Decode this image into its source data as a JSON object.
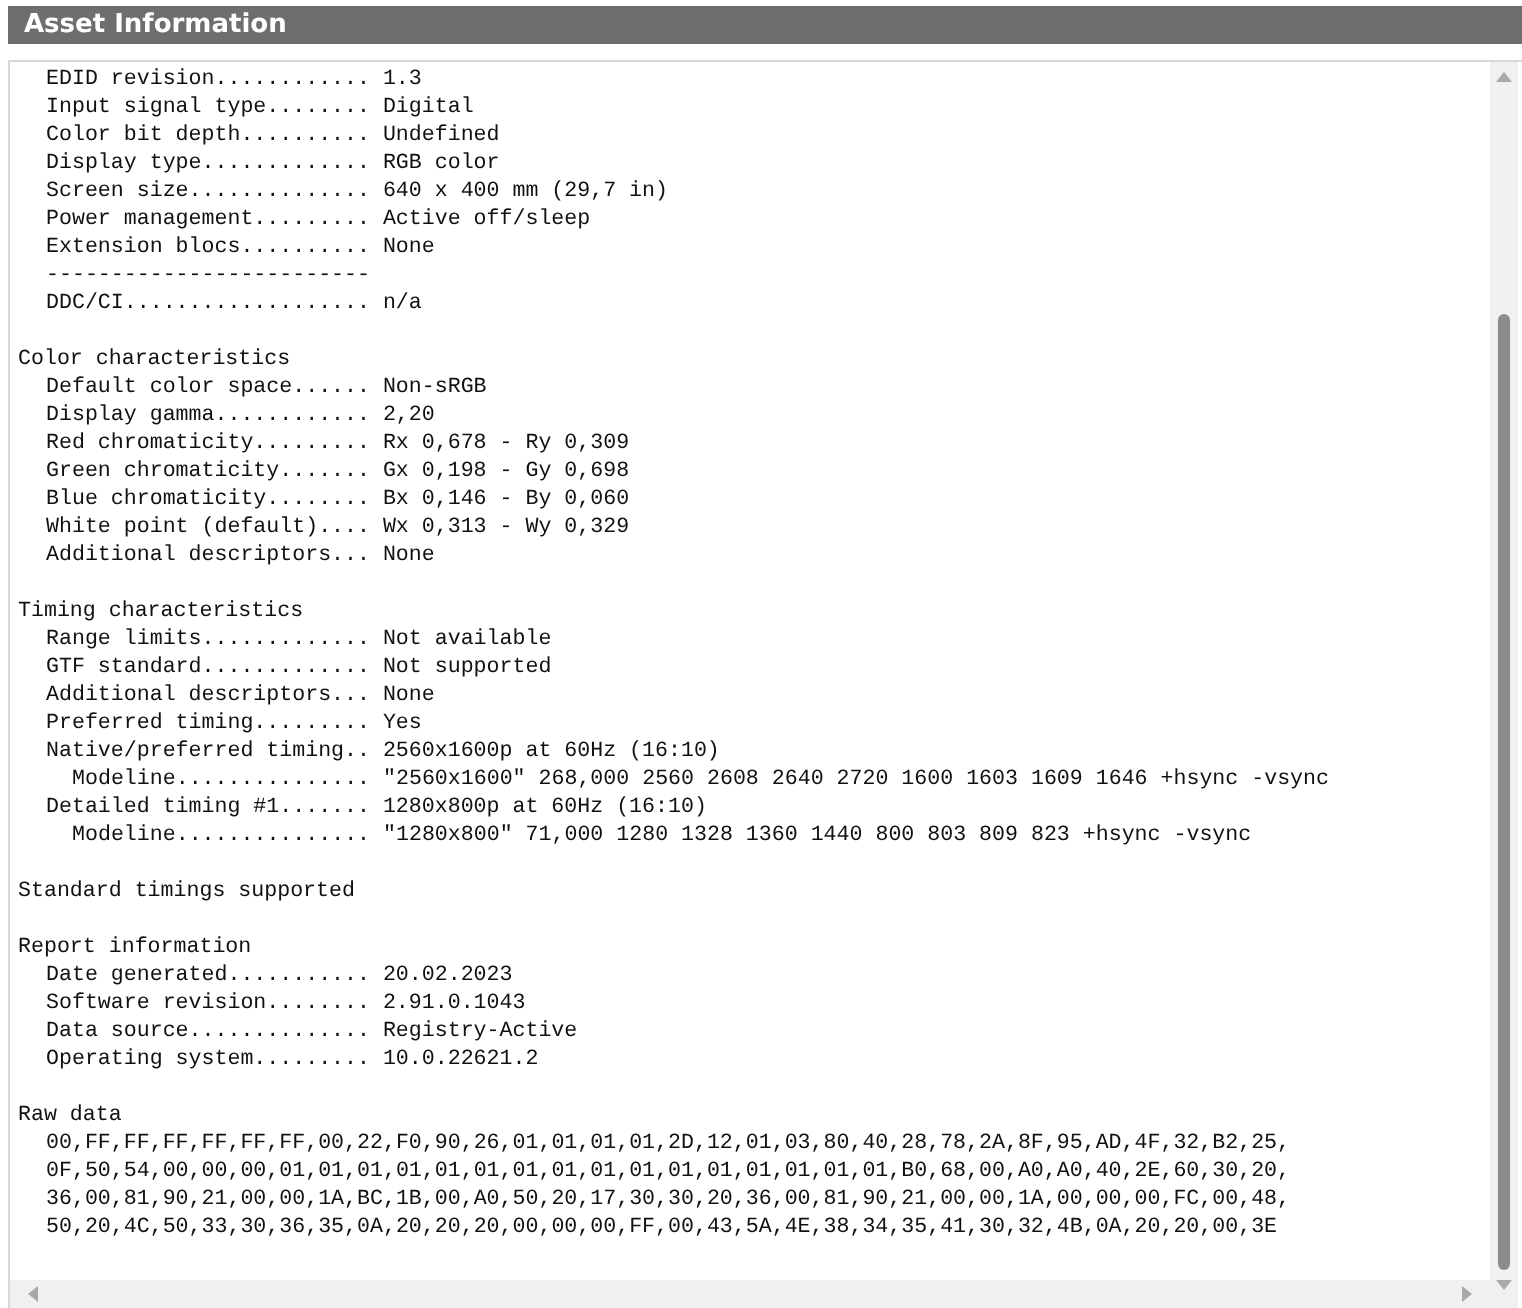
{
  "header": {
    "title": "Asset Information"
  },
  "sections": [
    {
      "rows": [
        {
          "kind": "field",
          "label": "EDID revision............",
          "value": "1.3"
        },
        {
          "kind": "field",
          "label": "Input signal type........",
          "value": "Digital"
        },
        {
          "kind": "field",
          "label": "Color bit depth..........",
          "value": "Undefined"
        },
        {
          "kind": "field",
          "label": "Display type.............",
          "value": "RGB color"
        },
        {
          "kind": "field",
          "label": "Screen size..............",
          "value": "640 x 400 mm (29,7 in)"
        },
        {
          "kind": "field",
          "label": "Power management.........",
          "value": "Active off/sleep"
        },
        {
          "kind": "field",
          "label": "Extension blocs..........",
          "value": "None"
        },
        {
          "kind": "separator",
          "text": "-------------------------"
        },
        {
          "kind": "field",
          "label": "DDC/CI...................",
          "value": "n/a"
        }
      ]
    },
    {
      "title": "Color characteristics",
      "rows": [
        {
          "kind": "field",
          "label": "Default color space......",
          "value": "Non-sRGB"
        },
        {
          "kind": "field",
          "label": "Display gamma............",
          "value": "2,20"
        },
        {
          "kind": "field",
          "label": "Red chromaticity.........",
          "value": "Rx 0,678 - Ry 0,309"
        },
        {
          "kind": "field",
          "label": "Green chromaticity.......",
          "value": "Gx 0,198 - Gy 0,698"
        },
        {
          "kind": "field",
          "label": "Blue chromaticity........",
          "value": "Bx 0,146 - By 0,060"
        },
        {
          "kind": "field",
          "label": "White point (default)....",
          "value": "Wx 0,313 - Wy 0,329"
        },
        {
          "kind": "field",
          "label": "Additional descriptors...",
          "value": "None"
        }
      ]
    },
    {
      "title": "Timing characteristics",
      "rows": [
        {
          "kind": "field",
          "label": "Range limits.............",
          "value": "Not available"
        },
        {
          "kind": "field",
          "label": "GTF standard.............",
          "value": "Not supported"
        },
        {
          "kind": "field",
          "label": "Additional descriptors...",
          "value": "None"
        },
        {
          "kind": "field",
          "label": "Preferred timing.........",
          "value": "Yes"
        },
        {
          "kind": "field",
          "label": "Native/preferred timing..",
          "value": "2560x1600p at 60Hz (16:10)",
          "children": [
            {
              "kind": "field",
              "label": "Modeline...............",
              "value": "\"2560x1600\" 268,000 2560 2608 2640 2720 1600 1603 1609 1646 +hsync -vsync"
            }
          ]
        },
        {
          "kind": "field",
          "label": "Detailed timing #1.......",
          "value": "1280x800p at 60Hz (16:10)",
          "children": [
            {
              "kind": "field",
              "label": "Modeline...............",
              "value": "\"1280x800\" 71,000 1280 1328 1360 1440 800 803 809 823 +hsync -vsync"
            }
          ]
        }
      ]
    },
    {
      "title": "Standard timings supported"
    },
    {
      "title": "Report information",
      "rows": [
        {
          "kind": "field",
          "label": "Date generated...........",
          "value": "20.02.2023"
        },
        {
          "kind": "field",
          "label": "Software revision........",
          "value": "2.91.0.1043"
        },
        {
          "kind": "field",
          "label": "Data source..............",
          "value": "Registry-Active"
        },
        {
          "kind": "field",
          "label": "Operating system.........",
          "value": "10.0.22621.2"
        }
      ]
    },
    {
      "title": "Raw data",
      "rows": [
        {
          "kind": "text",
          "text": "00,FF,FF,FF,FF,FF,FF,00,22,F0,90,26,01,01,01,01,2D,12,01,03,80,40,28,78,2A,8F,95,AD,4F,32,B2,25,"
        },
        {
          "kind": "text",
          "text": "0F,50,54,00,00,00,01,01,01,01,01,01,01,01,01,01,01,01,01,01,01,01,B0,68,00,A0,A0,40,2E,60,30,20,"
        },
        {
          "kind": "text",
          "text": "36,00,81,90,21,00,00,1A,BC,1B,00,A0,50,20,17,30,30,20,36,00,81,90,21,00,00,1A,00,00,00,FC,00,48,"
        },
        {
          "kind": "text",
          "text": "50,20,4C,50,33,30,36,35,0A,20,20,20,00,00,00,FF,00,43,5A,4E,38,34,35,41,30,32,4B,0A,20,20,00,3E"
        }
      ]
    }
  ]
}
